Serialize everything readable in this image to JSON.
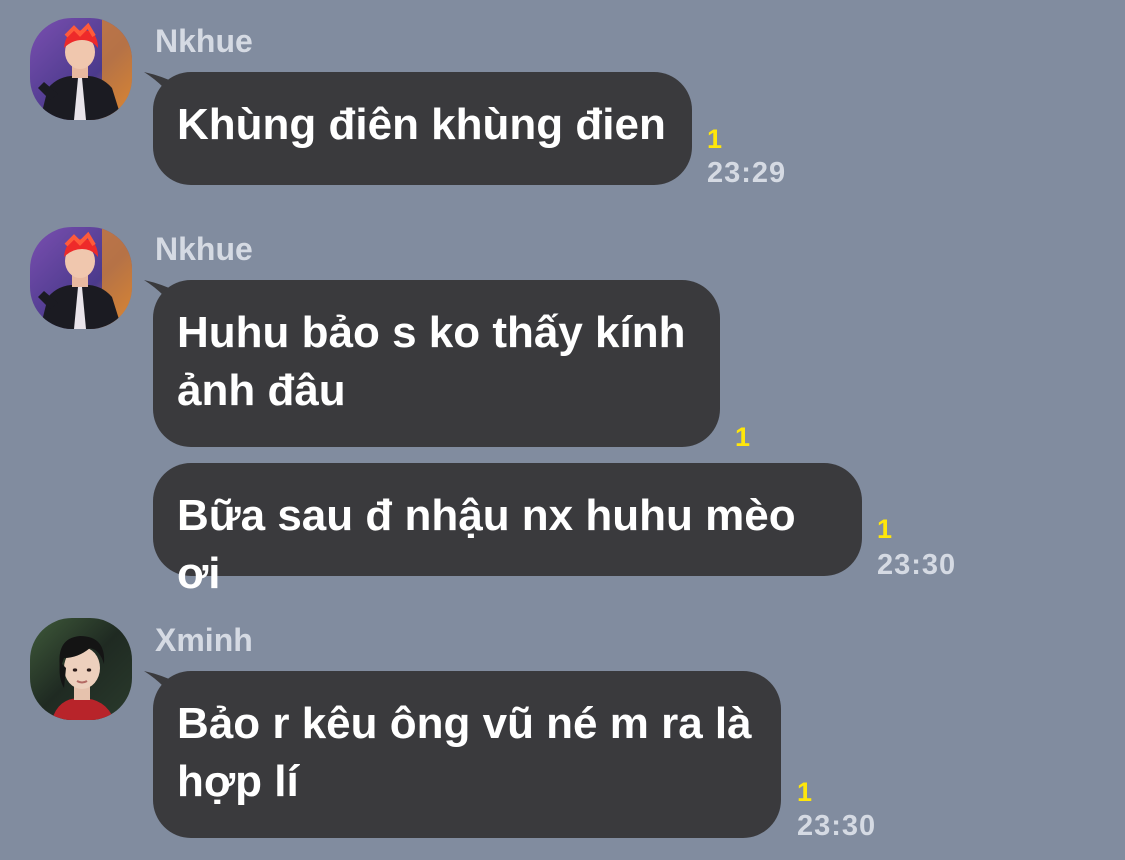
{
  "theme": {
    "background": "#818c9f",
    "bubble": "#3a3a3d",
    "bubble_text": "#ffffff",
    "meta_text": "#d5dae3",
    "unread_color": "#ffe60a"
  },
  "messages": [
    {
      "sender": "Nkhue",
      "avatar": "avatar-red-hair-performer",
      "text": "Khùng điên khùng đien",
      "unread": "1",
      "time": "23:29"
    },
    {
      "sender": "Nkhue",
      "avatar": "avatar-red-hair-performer",
      "text": "Huhu bảo s ko thấy kính\nảnh đâu",
      "unread": "1",
      "time": ""
    },
    {
      "sender": "",
      "avatar": "",
      "text": "Bữa sau đ nhậu nx huhu mèo ơi",
      "unread": "1",
      "time": "23:30"
    },
    {
      "sender": "Xminh",
      "avatar": "avatar-dark-hair-portrait",
      "text": "Bảo r kêu ông vũ né m ra là\nhợp lí",
      "unread": "1",
      "time": "23:30"
    }
  ]
}
